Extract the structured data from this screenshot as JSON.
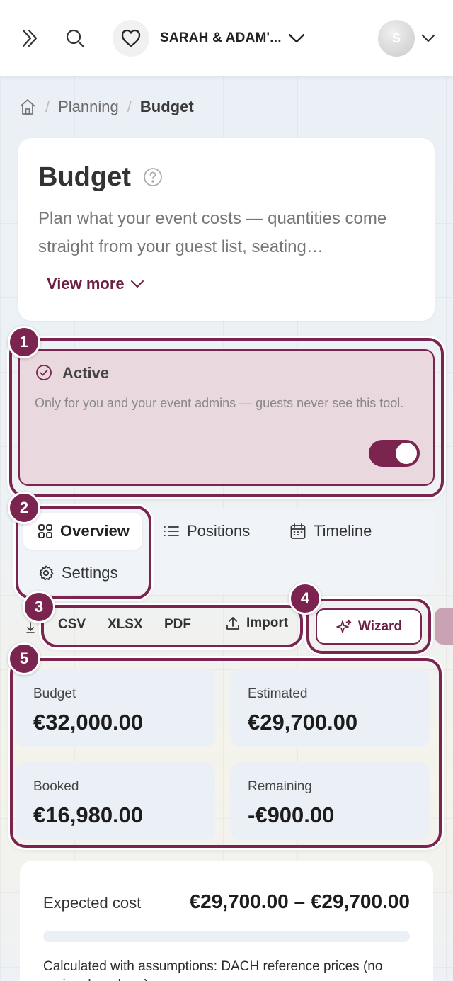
{
  "header": {
    "event_name": "SARAH & ADAM'...",
    "avatar_initial": "S"
  },
  "breadcrumb": {
    "items": [
      "Planning",
      "Budget"
    ]
  },
  "intro": {
    "title": "Budget",
    "description": "Plan what your event costs — quantities come straight from your guest list, seating…",
    "view_more": "View more"
  },
  "status": {
    "badge": "1",
    "label": "Active",
    "description": "Only for you and your event admins — guests never see this tool.",
    "toggle_on": true
  },
  "tabs": {
    "badge": "2",
    "items": [
      {
        "label": "Overview",
        "icon": "grid-icon",
        "selected": true
      },
      {
        "label": "Positions",
        "icon": "list-icon",
        "selected": false
      },
      {
        "label": "Timeline",
        "icon": "calendar-icon",
        "selected": false
      },
      {
        "label": "Settings",
        "icon": "gear-icon",
        "selected": false
      }
    ]
  },
  "export": {
    "badge": "3",
    "csv": "CSV",
    "xlsx": "XLSX",
    "pdf": "PDF",
    "import": "Import"
  },
  "wizard": {
    "badge": "4",
    "label": "Wizard"
  },
  "stats": {
    "badge": "5",
    "items": [
      {
        "label": "Budget",
        "value": "€32,000.00"
      },
      {
        "label": "Estimated",
        "value": "€29,700.00"
      },
      {
        "label": "Booked",
        "value": "€16,980.00"
      },
      {
        "label": "Remaining",
        "value": "-€900.00"
      }
    ]
  },
  "expected": {
    "label": "Expected cost",
    "value": "€29,700.00 – €29,700.00",
    "note": "Calculated with assumptions: DACH reference prices (no regional mark-up)"
  },
  "colors": {
    "accent": "#7c2450",
    "active_bg": "#ead8df"
  }
}
